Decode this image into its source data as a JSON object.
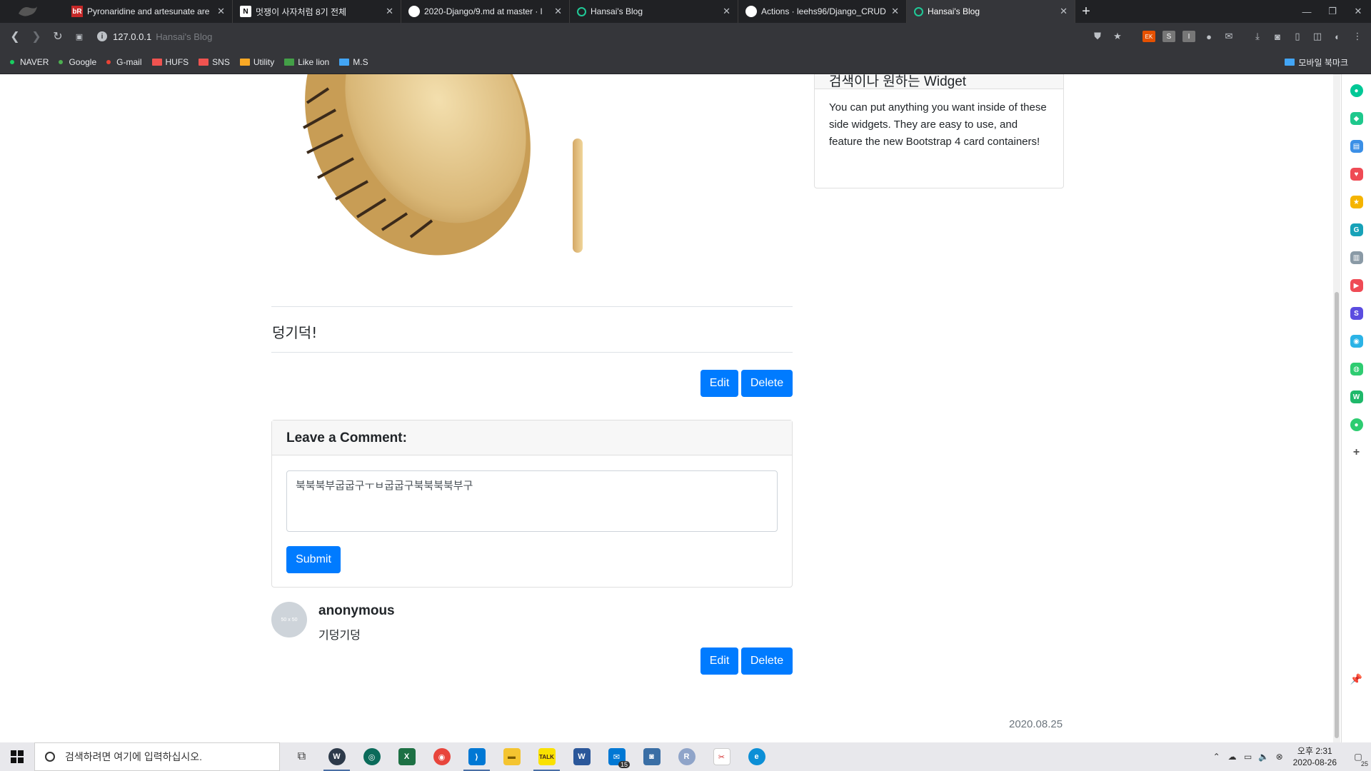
{
  "browser": {
    "tabs": [
      {
        "title": "Pyronaridine and artesunate are",
        "favicon": "bR",
        "favicon_color": "#c62828",
        "active": false
      },
      {
        "title": "멋쟁이 사자처럼 8기 전체",
        "favicon": "N",
        "favicon_color": "#ffffff",
        "active": false
      },
      {
        "title": "2020-Django/9.md at master · l",
        "favicon": "github",
        "favicon_color": "#ffffff",
        "active": false
      },
      {
        "title": "Hansai's Blog",
        "favicon": "globe",
        "favicon_color": "#20c997",
        "active": false
      },
      {
        "title": "Actions · leehs96/Django_CRUD",
        "favicon": "github",
        "favicon_color": "#ffffff",
        "active": false
      },
      {
        "title": "Hansai's Blog",
        "favicon": "globe",
        "favicon_color": "#20c997",
        "active": true
      }
    ],
    "address": {
      "host": "127.0.0.1",
      "title": "Hansai's Blog"
    },
    "bookmarks": [
      {
        "label": "NAVER",
        "type": "dot",
        "color": "#19ce60"
      },
      {
        "label": "Google",
        "type": "dot",
        "color": "#4caf50"
      },
      {
        "label": "G-mail",
        "type": "dot",
        "color": "#ea4335"
      },
      {
        "label": "HUFS",
        "type": "folder",
        "color": "#ef5350"
      },
      {
        "label": "SNS",
        "type": "folder",
        "color": "#ef5350"
      },
      {
        "label": "Utility",
        "type": "folder",
        "color": "#f9a825"
      },
      {
        "label": "Like lion",
        "type": "folder",
        "color": "#43a047"
      },
      {
        "label": "M.S",
        "type": "folder",
        "color": "#42a5f5"
      }
    ],
    "mobile_bookmarks": "모바일 북마크"
  },
  "sidebar_widget": {
    "header_partial": "검색이나 원하는 Widget",
    "body": "You can put anything you want inside of these side widgets. They are easy to use, and feature the new Bootstrap 4 card containers!"
  },
  "post": {
    "body": "덩기덕!",
    "edit_label": "Edit",
    "delete_label": "Delete",
    "date": "2020.08.25"
  },
  "comment_form": {
    "header": "Leave a Comment:",
    "value": "북북북부굽굽구ㅜㅂ굽굽구북북북북부구",
    "submit_label": "Submit"
  },
  "comments": [
    {
      "author": "anonymous",
      "text": "기덩기덩",
      "edit_label": "Edit",
      "delete_label": "Delete",
      "avatar_text": "50 x 50"
    }
  ],
  "taskbar": {
    "search_placeholder": "검색하려면 여기에 입력하십시오.",
    "clock_time": "오후 2:31",
    "clock_date": "2020-08-26",
    "notification_count": "25",
    "mail_badge": "15"
  },
  "colors": {
    "primary": "#007bff",
    "chrome_dark": "#202124",
    "chrome": "#35363a"
  }
}
